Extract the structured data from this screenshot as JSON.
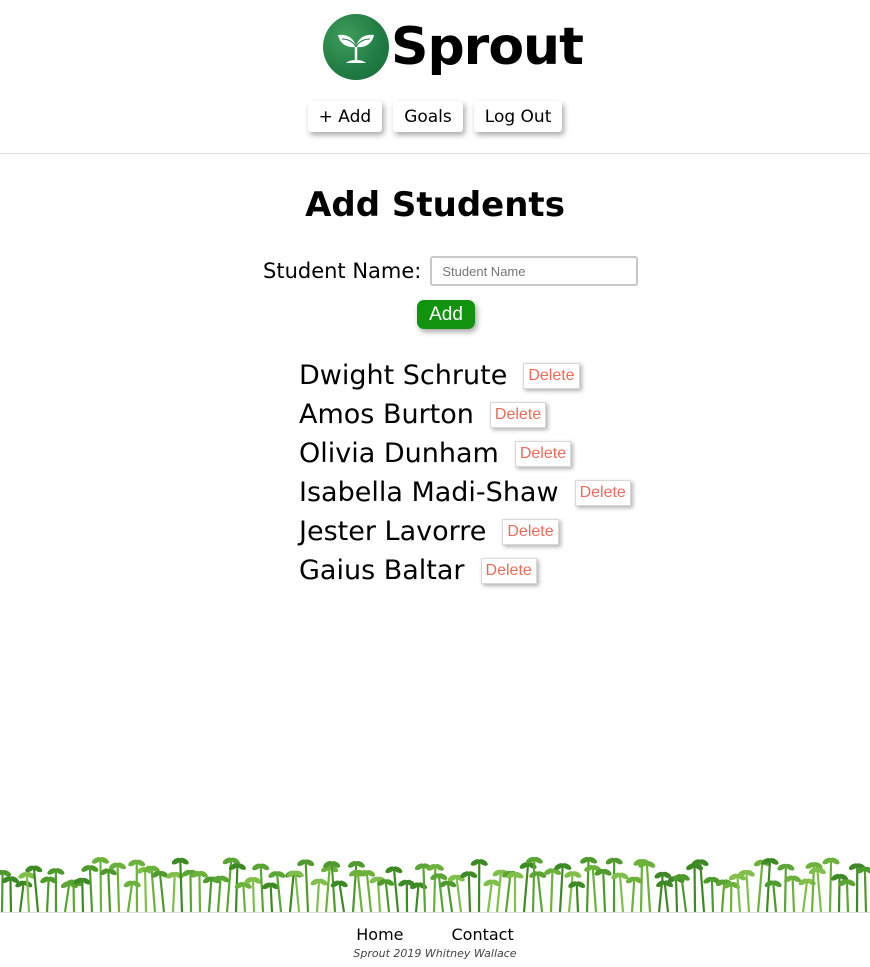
{
  "header": {
    "brand": "Sprout",
    "nav": [
      {
        "label": "+ Add"
      },
      {
        "label": "Goals"
      },
      {
        "label": "Log Out"
      }
    ]
  },
  "main": {
    "title": "Add Students",
    "form": {
      "label": "Student Name:",
      "placeholder": "Student Name",
      "value": "",
      "submit_label": "Add"
    },
    "students": [
      {
        "name": "Dwight Schrute",
        "delete_label": "Delete"
      },
      {
        "name": "Amos Burton",
        "delete_label": "Delete"
      },
      {
        "name": "Olivia Dunham",
        "delete_label": "Delete"
      },
      {
        "name": "Isabella Madi-Shaw",
        "delete_label": "Delete"
      },
      {
        "name": "Jester Lavorre",
        "delete_label": "Delete"
      },
      {
        "name": "Gaius Baltar",
        "delete_label": "Delete"
      }
    ]
  },
  "footer": {
    "links": [
      {
        "label": "Home"
      },
      {
        "label": "Contact"
      }
    ],
    "copyright": "Sprout 2019 Whitney Wallace"
  },
  "colors": {
    "accent_green": "#12930f",
    "delete_red": "#ee6b5a",
    "logo_green": "#1f7a43"
  }
}
